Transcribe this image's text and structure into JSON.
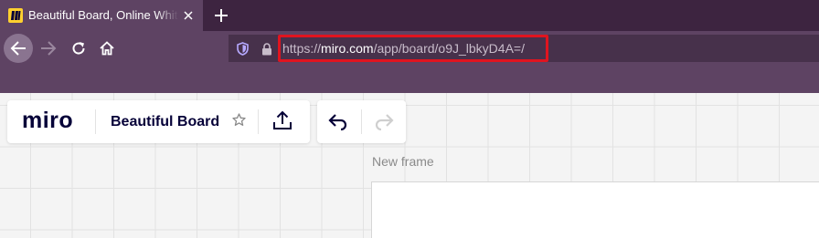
{
  "browser": {
    "tab": {
      "title": "Beautiful Board, Online Whiteboard for Visual Collaboration",
      "favicon": "miro-favicon-icon"
    },
    "new_tab_icon": "plus-icon",
    "nav": {
      "back_icon": "arrow-left-icon",
      "forward_icon": "arrow-right-icon",
      "reload_icon": "reload-icon",
      "home_icon": "home-icon"
    },
    "url": {
      "prefix": "https://",
      "domain": "miro.com",
      "path": "/app/board/o9J_lbkyD4A=/",
      "highlight_color": "#e0141f"
    },
    "colors": {
      "chrome": "#5e4363",
      "tabbar": "#3d2440",
      "urlbar": "#47314b"
    }
  },
  "board": {
    "logo": "miro",
    "name": "Beautiful Board",
    "star_icon": "star-outline-icon",
    "share_icon": "upload-icon",
    "undo_icon": "undo-icon",
    "redo_icon": "redo-icon",
    "frame_label": "New frame"
  }
}
